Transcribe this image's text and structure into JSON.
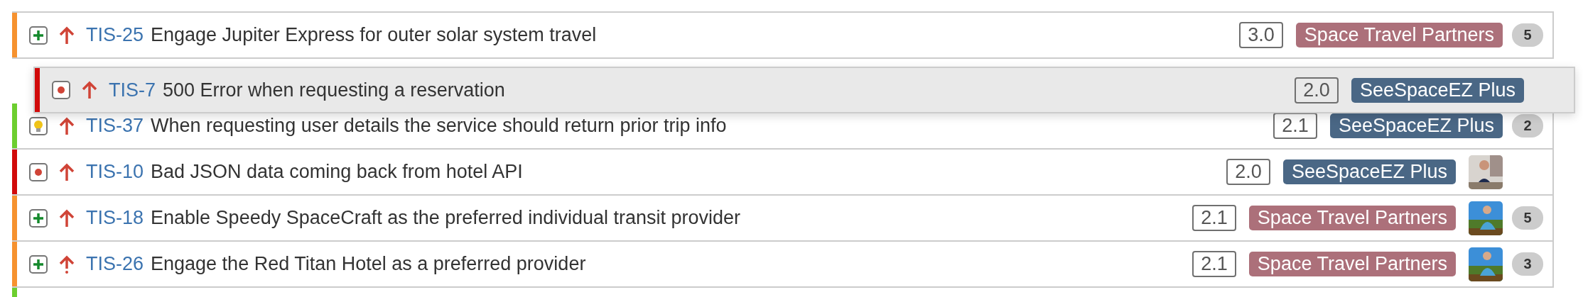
{
  "issues": [
    {
      "color": "#f6922f",
      "type_icon": {
        "kind": "story"
      },
      "priority_icon": {
        "kind": "major"
      },
      "key": "TIS-25",
      "summary": "Engage Jupiter Express for outer solar system travel",
      "version": "3.0",
      "label": {
        "text": "Space Travel Partners",
        "color": "#ac707a"
      },
      "count": "5"
    },
    {
      "color": "#6cce2f",
      "type_icon": {
        "kind": "improvement"
      },
      "priority_icon": {
        "kind": "major"
      },
      "key": "TIS-37",
      "summary": "When requesting user details the service should return prior trip info",
      "version": "2.1",
      "label": {
        "text": "SeeSpaceEZ Plus",
        "color": "#4a6785"
      },
      "count": "2"
    },
    {
      "color": "#d10a0a",
      "type_icon": {
        "kind": "bug"
      },
      "priority_icon": {
        "kind": "major"
      },
      "key": "TIS-10",
      "summary": "Bad JSON data coming back from hotel API",
      "version": "2.0",
      "label": {
        "text": "SeeSpaceEZ Plus",
        "color": "#4a6785"
      }
    },
    {
      "color": "#f6922f",
      "type_icon": {
        "kind": "story"
      },
      "priority_icon": {
        "kind": "major"
      },
      "key": "TIS-18",
      "summary": "Enable Speedy SpaceCraft as the preferred individual transit provider",
      "version": "2.1",
      "label": {
        "text": "Space Travel Partners",
        "color": "#ac707a"
      },
      "count": "5"
    },
    {
      "color": "#f6922f",
      "type_icon": {
        "kind": "story"
      },
      "priority_icon": {
        "kind": "critical"
      },
      "key": "TIS-26",
      "summary": "Engage the Red Titan Hotel as a preferred provider",
      "version": "2.1",
      "label": {
        "text": "Space Travel Partners",
        "color": "#ac707a"
      },
      "count": "3"
    },
    {
      "color": "#6cce2f"
    }
  ],
  "dragged": {
    "issue": {
      "color": "#d10a0a",
      "type_icon": {
        "kind": "bug"
      },
      "priority_icon": {
        "kind": "major"
      },
      "key": "TIS-7",
      "summary": "500 Error when requesting a reservation",
      "version": "2.0",
      "label": {
        "text": "SeeSpaceEZ Plus",
        "color": "#4a6785"
      }
    }
  }
}
